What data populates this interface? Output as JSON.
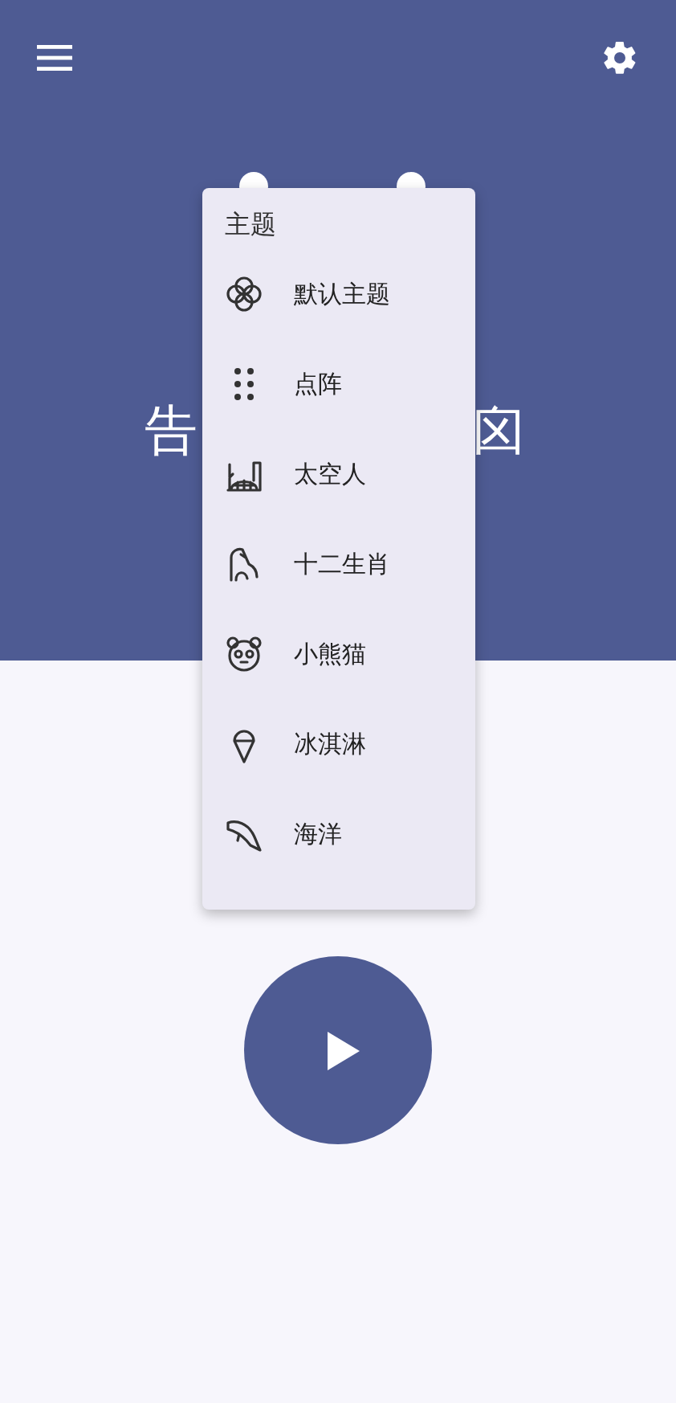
{
  "title_visible": [
    "告",
    "囟"
  ],
  "menu": {
    "heading": "主题",
    "items": [
      {
        "label": "默认主题",
        "kind": "clover"
      },
      {
        "label": "点阵",
        "kind": "dots"
      },
      {
        "label": "太空人",
        "kind": "dome"
      },
      {
        "label": "十二生肖",
        "kind": "horse"
      },
      {
        "label": "小熊猫",
        "kind": "panda"
      },
      {
        "label": "冰淇淋",
        "kind": "icecream"
      },
      {
        "label": "海洋",
        "kind": "dolphin"
      }
    ]
  }
}
